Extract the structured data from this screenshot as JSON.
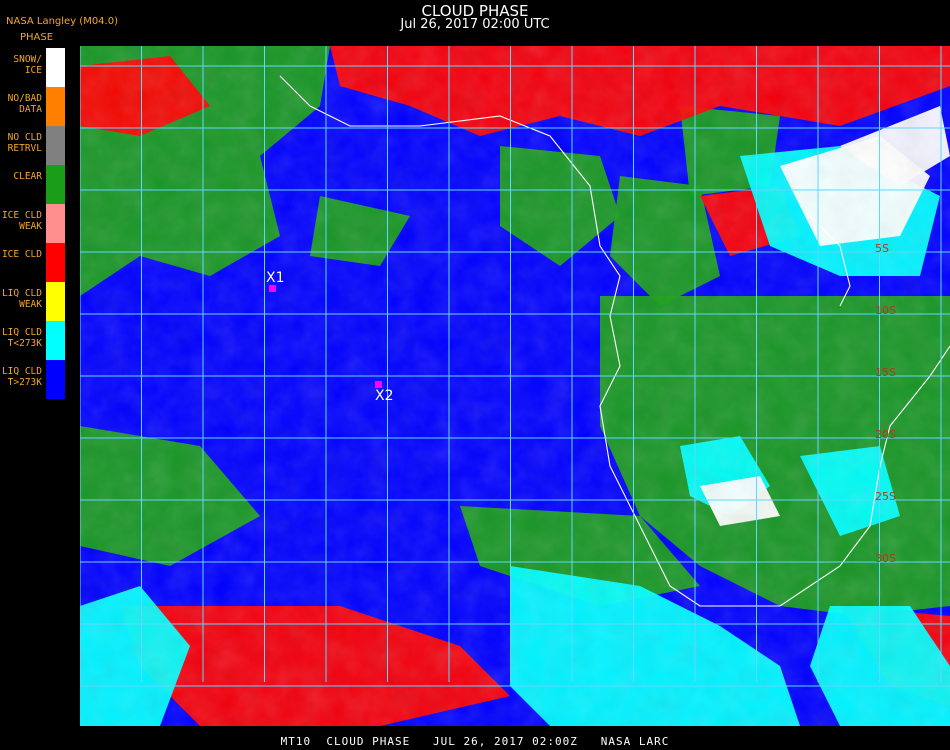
{
  "header": {
    "title": "CLOUD PHASE",
    "datetime": "Jul 26, 2017 02:00 UTC",
    "provider": "NASA Langley (M04.0)"
  },
  "legend": {
    "title": "PHASE",
    "items": [
      {
        "label": "SNOW/\nICE",
        "color": "#ffffff"
      },
      {
        "label": "NO/BAD\nDATA",
        "color": "#ff8000"
      },
      {
        "label": "NO CLD\nRETRVL",
        "color": "#808080"
      },
      {
        "label": "CLEAR",
        "color": "#1a9e1a"
      },
      {
        "label": "ICE CLD\nWEAK",
        "color": "#ff8f8f"
      },
      {
        "label": "ICE CLD",
        "color": "#ff0000"
      },
      {
        "label": "LIQ CLD\nWEAK",
        "color": "#ffff00"
      },
      {
        "label": "LIQ CLD\nT<273K",
        "color": "#00ffff"
      },
      {
        "label": "LIQ CLD\nT>273K",
        "color": "#0000ff"
      }
    ]
  },
  "markers": [
    {
      "label": "X1",
      "color": "#ff00ff"
    },
    {
      "label": "X2",
      "color": "#ff00ff"
    }
  ],
  "lat_labels": [
    "5S",
    "10S",
    "15S",
    "20S",
    "25S",
    "30S"
  ],
  "colors": {
    "grid": "#5fd7ff",
    "coast": "#ffffff",
    "lat_label": "#b03a1a"
  },
  "footer": "MT10  CLOUD PHASE   JUL 26, 2017 02:00Z   NASA LARC"
}
